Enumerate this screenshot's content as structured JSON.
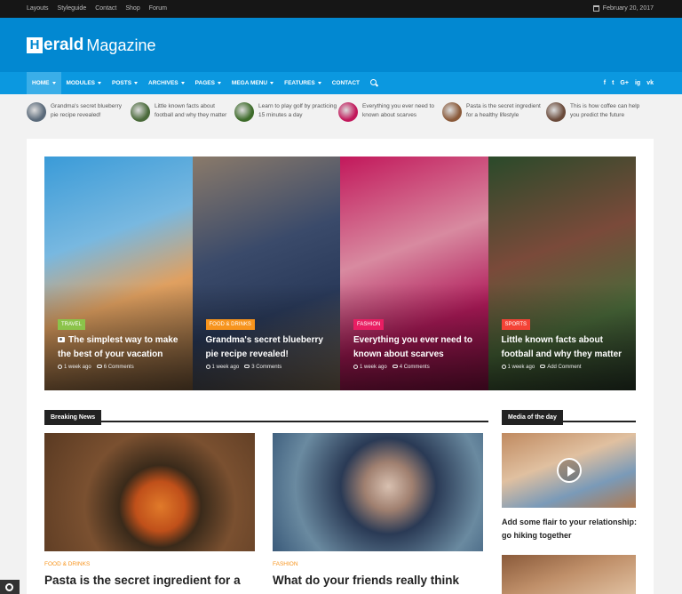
{
  "topbar": {
    "links": [
      "Layouts",
      "Styleguide",
      "Contact",
      "Shop",
      "Forum"
    ],
    "date": "February 20, 2017"
  },
  "logo": {
    "brand": "erald",
    "tagline": "Magazine",
    "mark": "H"
  },
  "nav": {
    "items": [
      {
        "label": "HOME",
        "caret": true
      },
      {
        "label": "MODULES",
        "caret": true
      },
      {
        "label": "POSTS",
        "caret": true
      },
      {
        "label": "ARCHIVES",
        "caret": true
      },
      {
        "label": "PAGES",
        "caret": true
      },
      {
        "label": "MEGA MENU",
        "caret": true
      },
      {
        "label": "FEATURES",
        "caret": true
      },
      {
        "label": "CONTACT",
        "caret": false
      }
    ],
    "social": [
      "f",
      "t",
      "G+",
      "ig",
      "vk"
    ]
  },
  "ticker": [
    {
      "text": "Grandma's secret blueberry pie recipe revealed!",
      "color": "#5a6a7a"
    },
    {
      "text": "Little known facts about football and why they matter",
      "color": "#4a6a3a"
    },
    {
      "text": "Learn to play golf by practicing 15 minutes a day",
      "color": "#3d6b2a"
    },
    {
      "text": "Everything you ever need to known about scarves",
      "color": "#c2185b"
    },
    {
      "text": "Pasta is the secret ingredient for a healthy lifestyle",
      "color": "#8a5a3a"
    },
    {
      "text": "This is how coffee can help you predict the future",
      "color": "#6a4a3a"
    }
  ],
  "featured": [
    {
      "category": "TRAVEL",
      "cat_color": "#8bc34a",
      "title": "The simplest way to make the best of your vacation",
      "time": "1 week ago",
      "comments": "6 Comments",
      "camera": true,
      "bg": "linear-gradient(160deg,#3a9bd8 0%,#78b8e0 35%,#e0a060 60%,#7a5a3a 100%)"
    },
    {
      "category": "FOOD & DRINKS",
      "cat_color": "#f7941d",
      "title": "Grandma's secret blueberry pie recipe revealed!",
      "time": "1 week ago",
      "comments": "3 Comments",
      "camera": false,
      "bg": "linear-gradient(160deg,#8a7a6a 0%,#3a4a6a 40%,#2a3a5a 65%,#7a6a55 100%)"
    },
    {
      "category": "FASHION",
      "cat_color": "#e91e63",
      "title": "Everything you ever need to known about scarves",
      "time": "1 week ago",
      "comments": "4 Comments",
      "camera": false,
      "bg": "linear-gradient(160deg,#c2185b 0%,#d88aa0 40%,#b01a5a 70%,#801040 100%)"
    },
    {
      "category": "SPORTS",
      "cat_color": "#f44336",
      "title": "Little known facts about football and why they matter",
      "time": "1 week ago",
      "comments": "Add Comment",
      "camera": false,
      "bg": "linear-gradient(160deg,#2a4a2a 0%,#7a4a3a 40%,#4a6a3a 70%,#2a3a2a 100%)"
    }
  ],
  "breaking": {
    "heading": "Breaking News",
    "posts": [
      {
        "category": "FOOD & DRINKS",
        "title": "Pasta is the secret ingredient for a",
        "bg": "radial-gradient(circle at 55% 62%,#e07a2a 0%,#c0501a 18%,#3a2a1a 30%,#7a5030 55%,#5a3a22 100%)"
      },
      {
        "category": "FASHION",
        "title": "What do your friends really think",
        "bg": "radial-gradient(circle at 55% 45%,#d8c0b0 0%,#a08070 18%,#2a3a55 36%,#6a8aa0 70%,#3a5a7a 100%)"
      }
    ]
  },
  "media": {
    "heading": "Media of the day",
    "title": "Add some flair to your relationship: go hiking together",
    "bg1": "linear-gradient(160deg,#c08a60 0%,#e0c0a0 40%,#7a9ab8 70%,#b07a50 100%)",
    "bg2": "linear-gradient(160deg,#8a5a3a 0%,#c0906a 50%,#e0c0a0 100%)"
  }
}
